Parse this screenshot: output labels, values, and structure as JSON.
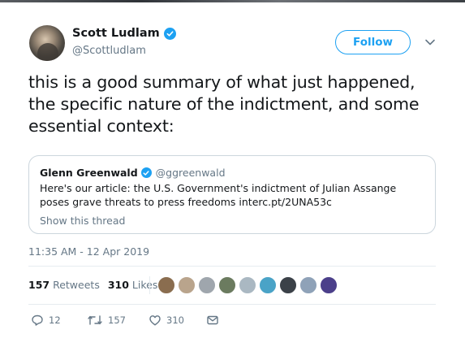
{
  "author": {
    "name": "Scott Ludlam",
    "handle": "@Scottludlam",
    "verified": true
  },
  "follow_button": {
    "label": "Follow"
  },
  "tweet": {
    "text": "this is a good summary of what just happened, the specific nature of the indictment, and some essential context:"
  },
  "quoted_tweet": {
    "name": "Glenn Greenwald",
    "handle": "@ggreenwald",
    "verified": true,
    "text": "Here's our article: the U.S. Government's indictment of Julian Assange poses grave threats to press freedoms interc.pt/2UNA53c",
    "thread_link": "Show this thread"
  },
  "timestamp": "11:35 AM - 12 Apr 2019",
  "stats": {
    "retweets_count": "157",
    "retweets_label": "Retweets",
    "likes_count": "310",
    "likes_label": "Likes"
  },
  "liker_avatars": [
    {
      "color": "#8a6d4f"
    },
    {
      "color": "#b9a48c"
    },
    {
      "color": "#9fa6ad"
    },
    {
      "color": "#6b7b5f"
    },
    {
      "color": "#aab8c2"
    },
    {
      "color": "#4aa3c7"
    },
    {
      "color": "#3b4148"
    },
    {
      "color": "#8fa2b8"
    },
    {
      "color": "#4b3f8a"
    }
  ],
  "actions": {
    "reply_count": "12",
    "retweet_count": "157",
    "like_count": "310"
  },
  "colors": {
    "accent": "#1da1f2",
    "secondary_text": "#657786",
    "border": "#ccd6dd"
  },
  "icons": [
    "verified-badge-icon",
    "chevron-down-icon",
    "reply-icon",
    "retweet-icon",
    "heart-icon",
    "message-icon"
  ]
}
